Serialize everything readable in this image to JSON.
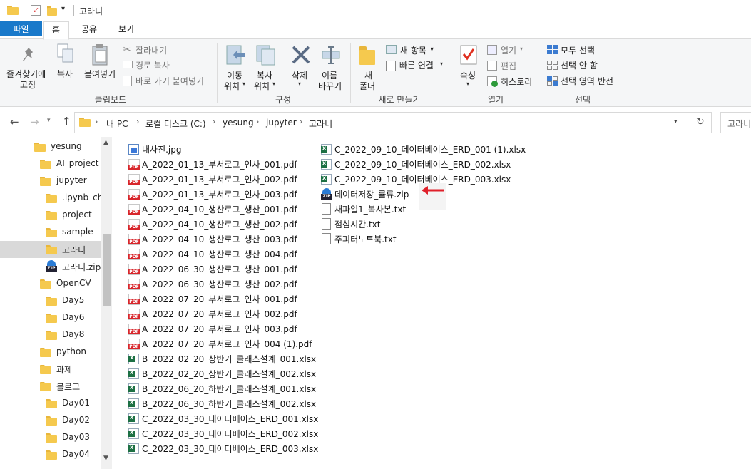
{
  "window": {
    "title": "고라니"
  },
  "tabs": [
    {
      "label": "파일"
    },
    {
      "label": "홈"
    },
    {
      "label": "공유"
    },
    {
      "label": "보기"
    }
  ],
  "ribbon": {
    "clipboard": {
      "pin_label1": "즐겨찾기에",
      "pin_label2": "고정",
      "copy": "복사",
      "paste": "붙여넣기",
      "cut": "잘라내기",
      "copy_path": "경로 복사",
      "paste_shortcut": "바로 가기 붙여넣기",
      "group": "클립보드"
    },
    "organize": {
      "move1": "이동",
      "move2": "위치",
      "copy1": "복사",
      "copy2": "위치",
      "delete": "삭제",
      "rename1": "이름",
      "rename2": "바꾸기",
      "group": "구성"
    },
    "new": {
      "new1": "새",
      "new2": "폴더",
      "new_item": "새 항목",
      "easy_access": "빠른 연결",
      "group": "새로 만들기"
    },
    "open": {
      "props": "속성",
      "open": "열기",
      "edit": "편집",
      "history": "히스토리",
      "group": "열기"
    },
    "select": {
      "all": "모두 선택",
      "none": "선택 안 함",
      "invert": "선택 영역 반전",
      "group": "선택"
    }
  },
  "address": {
    "crumbs": [
      "내 PC",
      "로컬 디스크 (C:)",
      "yesung",
      "jupyter",
      "고라니"
    ],
    "search_placeholder": "고라니"
  },
  "sidebar": {
    "items": [
      {
        "label": "yesung",
        "icon": "folder-icon"
      },
      {
        "label": "AI_project",
        "icon": "folder-icon"
      },
      {
        "label": "jupyter",
        "icon": "folder-icon"
      },
      {
        "label": ".ipynb_che",
        "icon": "folder-icon"
      },
      {
        "label": "project",
        "icon": "folder-icon"
      },
      {
        "label": "sample",
        "icon": "folder-icon"
      },
      {
        "label": "고라니",
        "icon": "folder-icon"
      },
      {
        "label": "고라니.zip",
        "icon": "zip-icon"
      },
      {
        "label": "OpenCV",
        "icon": "folder-icon"
      },
      {
        "label": "Day5",
        "icon": "folder-icon"
      },
      {
        "label": "Day6",
        "icon": "folder-icon"
      },
      {
        "label": "Day8",
        "icon": "folder-icon"
      },
      {
        "label": "python",
        "icon": "folder-icon"
      },
      {
        "label": "과제",
        "icon": "folder-icon"
      },
      {
        "label": "블로그",
        "icon": "folder-icon"
      },
      {
        "label": "Day01",
        "icon": "folder-icon"
      },
      {
        "label": "Day02",
        "icon": "folder-icon"
      },
      {
        "label": "Day03",
        "icon": "folder-icon"
      },
      {
        "label": "Day04",
        "icon": "folder-icon"
      }
    ]
  },
  "files_col1": [
    {
      "name": "내사진.jpg",
      "type": "jpg"
    },
    {
      "name": "A_2022_01_13_부서로그_인사_001.pdf",
      "type": "pdf"
    },
    {
      "name": "A_2022_01_13_부서로그_인사_002.pdf",
      "type": "pdf"
    },
    {
      "name": "A_2022_01_13_부서로그_인사_003.pdf",
      "type": "pdf"
    },
    {
      "name": "A_2022_04_10_생산로그_생산_001.pdf",
      "type": "pdf"
    },
    {
      "name": "A_2022_04_10_생산로그_생산_002.pdf",
      "type": "pdf"
    },
    {
      "name": "A_2022_04_10_생산로그_생산_003.pdf",
      "type": "pdf"
    },
    {
      "name": "A_2022_04_10_생산로그_생산_004.pdf",
      "type": "pdf"
    },
    {
      "name": "A_2022_06_30_생산로그_생산_001.pdf",
      "type": "pdf"
    },
    {
      "name": "A_2022_06_30_생산로그_생산_002.pdf",
      "type": "pdf"
    },
    {
      "name": "A_2022_07_20_부서로그_인사_001.pdf",
      "type": "pdf"
    },
    {
      "name": "A_2022_07_20_부서로그_인사_002.pdf",
      "type": "pdf"
    },
    {
      "name": "A_2022_07_20_부서로그_인사_003.pdf",
      "type": "pdf"
    },
    {
      "name": "A_2022_07_20_부서로그_인사_004 (1).pdf",
      "type": "pdf"
    },
    {
      "name": "B_2022_02_20_상반기_클래스설계_001.xlsx",
      "type": "xls"
    },
    {
      "name": "B_2022_02_20_상반기_클래스설계_002.xlsx",
      "type": "xls"
    },
    {
      "name": "B_2022_06_20_하반기_클래스설계_001.xlsx",
      "type": "xls"
    },
    {
      "name": "B_2022_06_30_하반기_클래스설계_002.xlsx",
      "type": "xls"
    },
    {
      "name": "C_2022_03_30_데이터베이스_ERD_001.xlsx",
      "type": "xls"
    },
    {
      "name": "C_2022_03_30_데이터베이스_ERD_002.xlsx",
      "type": "xls"
    },
    {
      "name": "C_2022_03_30_데이터베이스_ERD_003.xlsx",
      "type": "xls"
    }
  ],
  "files_col2": [
    {
      "name": "C_2022_09_10_데이터베이스_ERD_001 (1).xlsx",
      "type": "xls"
    },
    {
      "name": "C_2022_09_10_데이터베이스_ERD_002.xlsx",
      "type": "xls"
    },
    {
      "name": "C_2022_09_10_데이터베이스_ERD_003.xlsx",
      "type": "xls"
    },
    {
      "name": "데이터저장_률류.zip",
      "type": "zip"
    },
    {
      "name": "새파일1_복사본.txt",
      "type": "txt"
    },
    {
      "name": "점심시간.txt",
      "type": "txt"
    },
    {
      "name": "주피터노트북.txt",
      "type": "txt"
    }
  ],
  "colors": {
    "accent": "#1979ca",
    "arrow": "#e0202a",
    "folder": "#f5c94e"
  }
}
